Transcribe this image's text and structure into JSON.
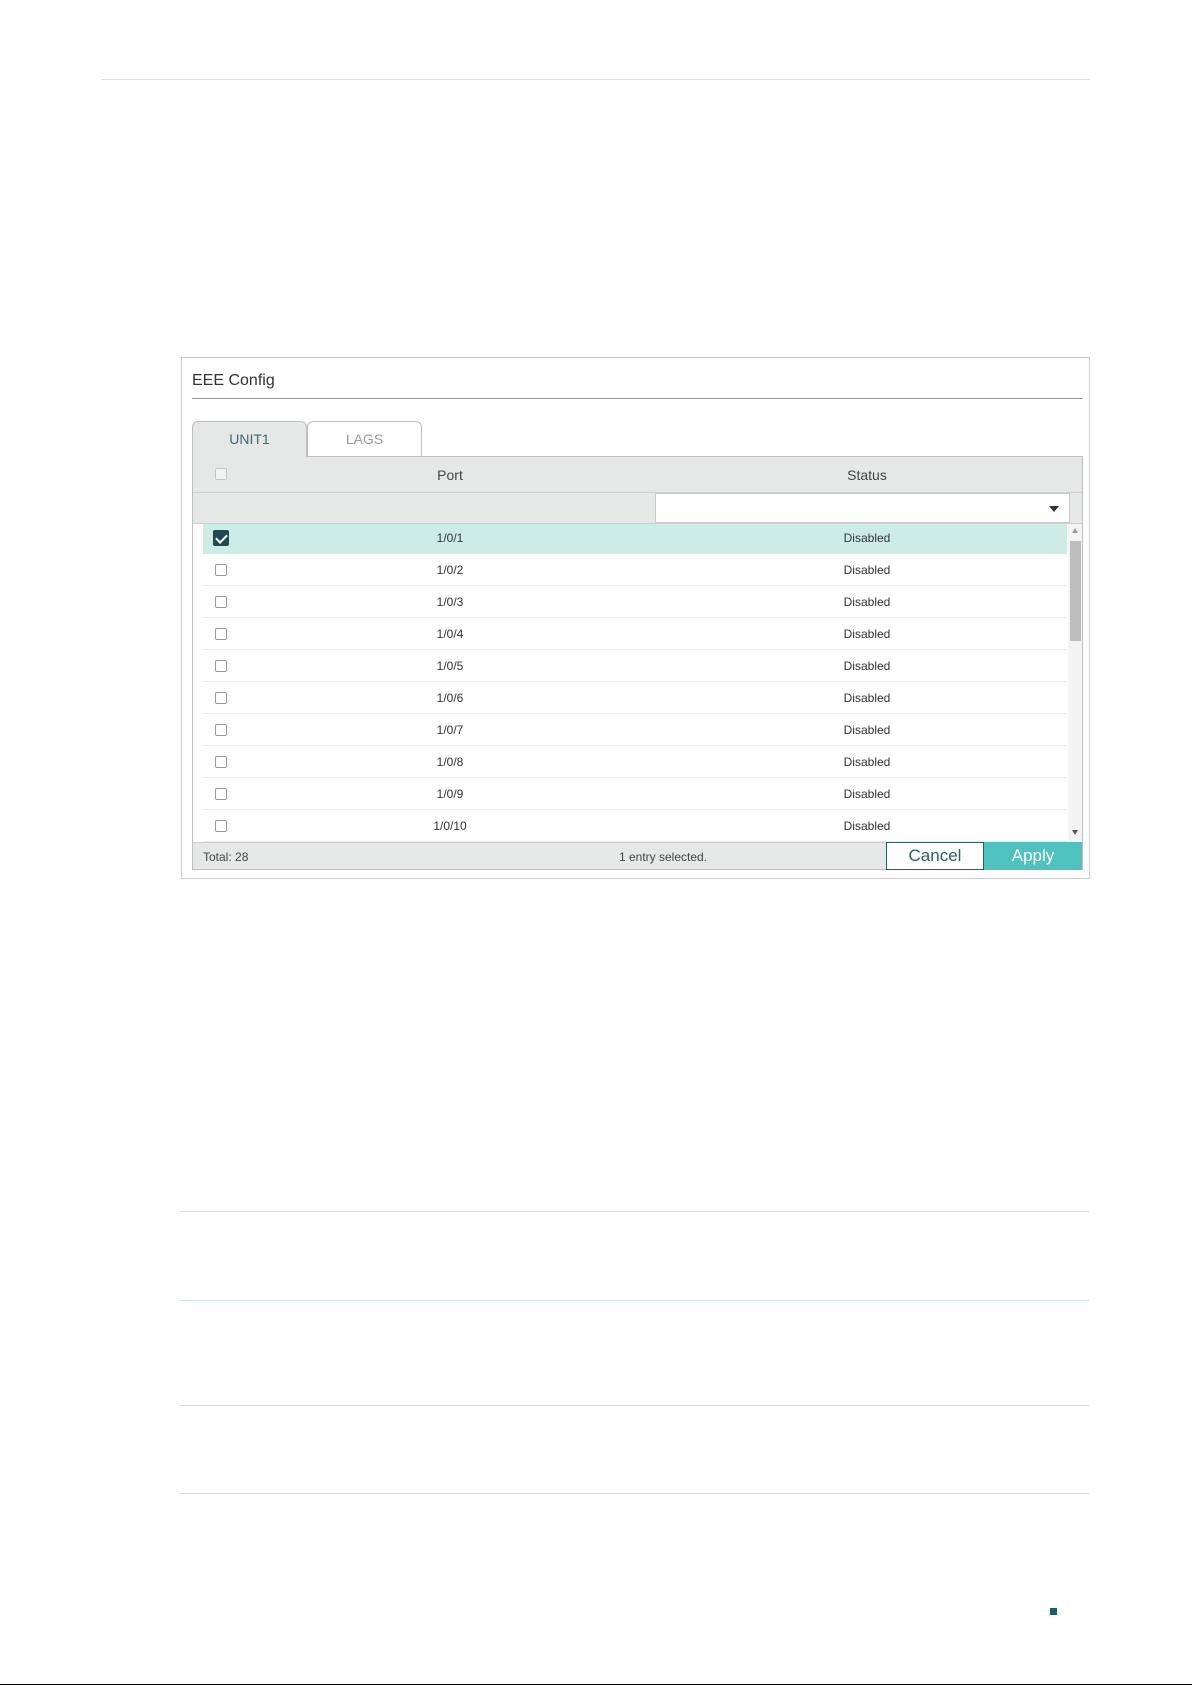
{
  "panel": {
    "title": "EEE Config",
    "tabs": [
      {
        "label": "UNIT1",
        "active": true
      },
      {
        "label": "LAGS",
        "active": false
      }
    ]
  },
  "table": {
    "columns": {
      "port": "Port",
      "status": "Status"
    },
    "status_filter_value": "",
    "rows": [
      {
        "port": "1/0/1",
        "status": "Disabled",
        "checked": true
      },
      {
        "port": "1/0/2",
        "status": "Disabled",
        "checked": false
      },
      {
        "port": "1/0/3",
        "status": "Disabled",
        "checked": false
      },
      {
        "port": "1/0/4",
        "status": "Disabled",
        "checked": false
      },
      {
        "port": "1/0/5",
        "status": "Disabled",
        "checked": false
      },
      {
        "port": "1/0/6",
        "status": "Disabled",
        "checked": false
      },
      {
        "port": "1/0/7",
        "status": "Disabled",
        "checked": false
      },
      {
        "port": "1/0/8",
        "status": "Disabled",
        "checked": false
      },
      {
        "port": "1/0/9",
        "status": "Disabled",
        "checked": false
      },
      {
        "port": "1/0/10",
        "status": "Disabled",
        "checked": false
      }
    ]
  },
  "footer": {
    "total": "Total: 28",
    "selected": "1 entry selected.",
    "cancel_label": "Cancel",
    "apply_label": "Apply"
  },
  "colors": {
    "accent": "#4fc1bf",
    "selected_row": "#cdece6",
    "dark_teal": "#1f4a52",
    "header_bg": "#e6e8e8"
  },
  "icons": {
    "filter_dropdown": "chevron-down-icon",
    "scroll_up": "arrow-up-icon",
    "scroll_down": "arrow-down-icon",
    "checkbox_checked": "checkmark-icon"
  }
}
